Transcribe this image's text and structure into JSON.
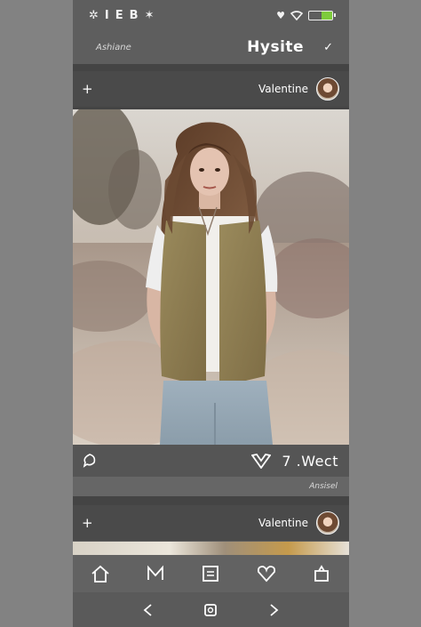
{
  "status_bar": {
    "left_glyphs": [
      "✲",
      "I",
      "E",
      "B",
      "✶"
    ],
    "icons": [
      "heart-icon",
      "wifi-icon",
      "battery-icon"
    ]
  },
  "app_bar": {
    "subtitle": "Ashiane",
    "brand": "Hysite",
    "check_icon": "check-icon"
  },
  "posts": [
    {
      "add_label": "+",
      "username": "Valentine",
      "comment_icon": "comment-bubble-icon",
      "like_icon": "heart-icon",
      "counter": "7 .Wect",
      "caption": "Ansisel"
    },
    {
      "add_label": "+",
      "username": "Valentine"
    }
  ],
  "tab_bar": {
    "items": [
      "home-icon",
      "messages-icon",
      "feed-icon",
      "likes-icon",
      "upload-icon"
    ]
  },
  "nav_bar": {
    "items": [
      "back-icon",
      "home-button-icon",
      "forward-icon"
    ]
  },
  "colors": {
    "background": "#828282",
    "phone": "#5e5e5e",
    "post_bar": "#4a4a4a",
    "battery_fill": "#7ecb3c"
  }
}
